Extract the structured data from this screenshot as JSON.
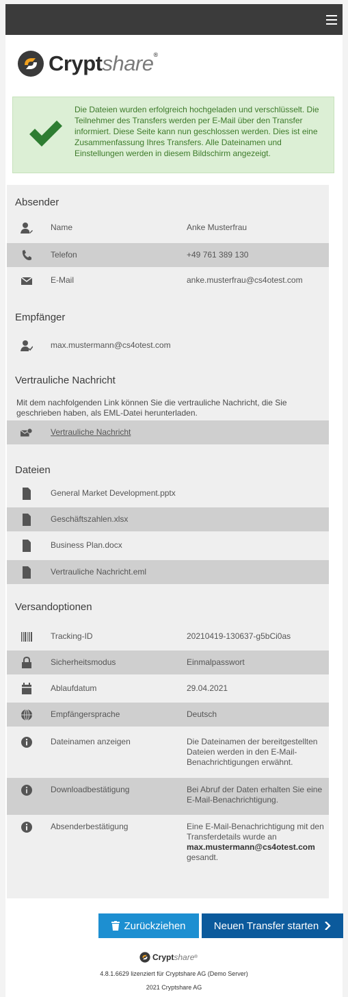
{
  "brand": {
    "name_bold": "Crypt",
    "name_light": "share",
    "reg": "®"
  },
  "alert": {
    "message": "Die Dateien wurden erfolgreich hochgeladen und verschlüsselt. Die Teilnehmer des Transfers werden per E-Mail über den Transfer informiert. Diese Seite kann nun geschlossen werden. Dies ist eine Zusammenfassung Ihres Transfers. Alle Dateinamen und Einstellungen werden in diesem Bildschirm angezeigt."
  },
  "sender": {
    "heading": "Absender",
    "rows": [
      {
        "icon": "user-edit-icon",
        "label": "Name",
        "value": "Anke Musterfrau"
      },
      {
        "icon": "phone-icon",
        "label": "Telefon",
        "value": "+49 761 389 130"
      },
      {
        "icon": "envelope-icon",
        "label": "E-Mail",
        "value": "anke.musterfrau@cs4otest.com"
      }
    ]
  },
  "recipients": {
    "heading": "Empfänger",
    "items": [
      "max.mustermann@cs4otest.com"
    ]
  },
  "confidential": {
    "heading": "Vertrauliche Nachricht",
    "description": "Mit dem nachfolgenden Link können Sie die vertrauliche Nachricht, die Sie geschrieben haben, als EML-Datei herunterladen.",
    "link_label": "Vertrauliche Nachricht"
  },
  "files": {
    "heading": "Dateien",
    "items": [
      "General Market Development.pptx",
      "Geschäftszahlen.xlsx",
      "Business Plan.docx",
      "Vertrauliche Nachricht.eml"
    ]
  },
  "options": {
    "heading": "Versandoptionen",
    "rows": [
      {
        "icon": "barcode-icon",
        "label": "Tracking-ID",
        "value": "20210419-130637-g5bCi0as"
      },
      {
        "icon": "lock-icon",
        "label": "Sicherheitsmodus",
        "value": "Einmalpasswort"
      },
      {
        "icon": "calendar-icon",
        "label": "Ablaufdatum",
        "value": "29.04.2021"
      },
      {
        "icon": "globe-icon",
        "label": "Empfängersprache",
        "value": "Deutsch"
      },
      {
        "icon": "info-icon",
        "label": "Dateinamen anzeigen",
        "value": "Die Dateinamen der bereitgestellten Dateien werden in den E-Mail-Benachrichtigungen erwähnt."
      },
      {
        "icon": "info-icon",
        "label": "Downloadbestätigung",
        "value": "Bei Abruf der Daten erhalten Sie eine E-Mail-Benachrichtigung."
      },
      {
        "icon": "info-icon",
        "label": "Absenderbestätigung",
        "value_pre": "Eine E-Mail-Benachrichtigung mit den Transferdetails wurde an",
        "value_bold": "max.mustermann@cs4otest.com",
        "value_post": "gesandt."
      }
    ]
  },
  "buttons": {
    "withdraw": "Zurückziehen",
    "new_transfer": "Neuen Transfer starten"
  },
  "footer": {
    "license": "4.8.1.6629 lizenziert für Cryptshare AG (Demo Server)",
    "copyright": "2021 Cryptshare AG"
  },
  "colors": {
    "navbar": "#3b3b3b",
    "success_bg": "#dcefd5",
    "success_text": "#3d7a2a",
    "check": "#2e7d32",
    "button_withdraw": "#1d8fd1",
    "button_new": "#0b5a9c",
    "logo_orange": "#f0a01e"
  }
}
